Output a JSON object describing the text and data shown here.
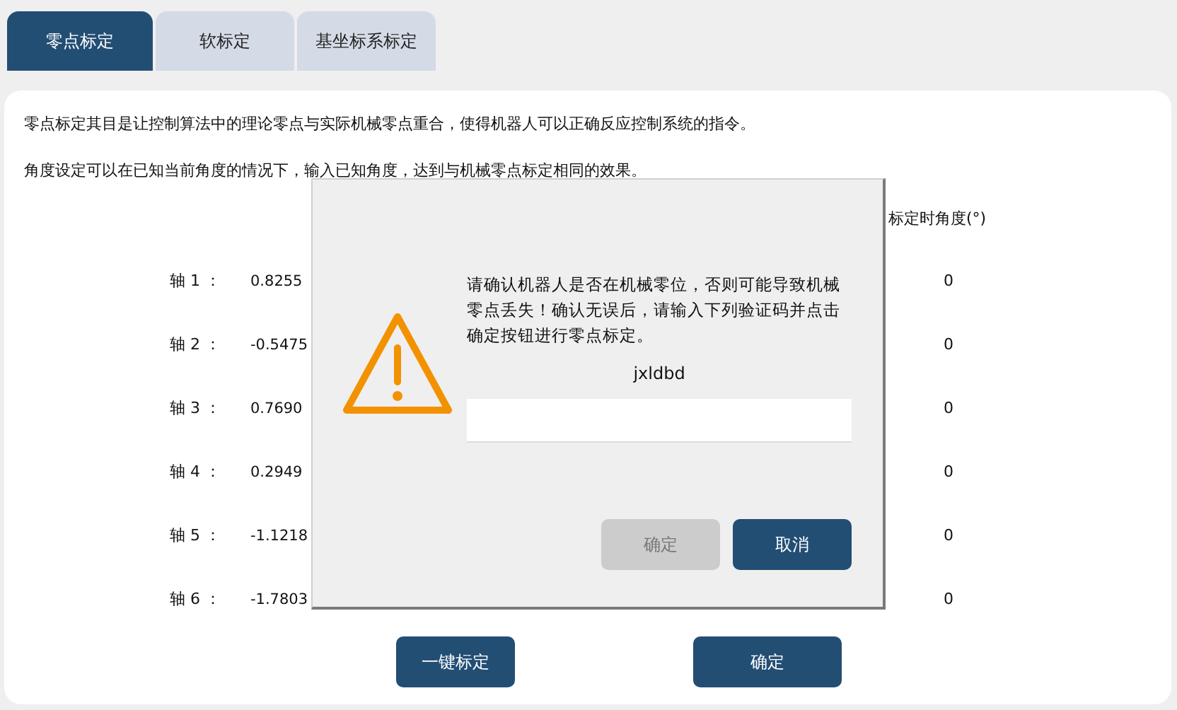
{
  "tabs": [
    {
      "label": "零点标定",
      "selected": true
    },
    {
      "label": "软标定",
      "selected": false
    },
    {
      "label": "基坐标系标定",
      "selected": false
    }
  ],
  "paragraphs": [
    "零点标定其目是让控制算法中的理论零点与实际机械零点重合，使得机器人可以正确反应控制系统的指令。",
    "角度设定可以在已知当前角度的情况下，输入已知角度，达到与机械零点标定相同的效果。"
  ],
  "column_header": "标定时角度(°)",
  "axes": [
    {
      "label": "轴 1 ：",
      "value": "0.8255",
      "angle": "0"
    },
    {
      "label": "轴 2 ：",
      "value": "-0.5475",
      "angle": "0"
    },
    {
      "label": "轴 3 ：",
      "value": "0.7690",
      "angle": "0"
    },
    {
      "label": "轴 4 ：",
      "value": "0.2949",
      "angle": "0"
    },
    {
      "label": "轴 5 ：",
      "value": "-1.1218",
      "angle": "0"
    },
    {
      "label": "轴 6 ：",
      "value": "-1.7803",
      "angle": "0"
    }
  ],
  "buttons": [
    {
      "label": "一键标定"
    },
    {
      "label": "确定"
    }
  ],
  "dialog": {
    "message": "请确认机器人是否在机械零位，否则可能导致机械零点丢失！确认无误后，请输入下列验证码并点击确定按钮进行零点标定。",
    "code": "jxldbd",
    "buttons": [
      {
        "label": "确定",
        "disabled": true
      },
      {
        "label": "取消",
        "disabled": false
      }
    ]
  }
}
